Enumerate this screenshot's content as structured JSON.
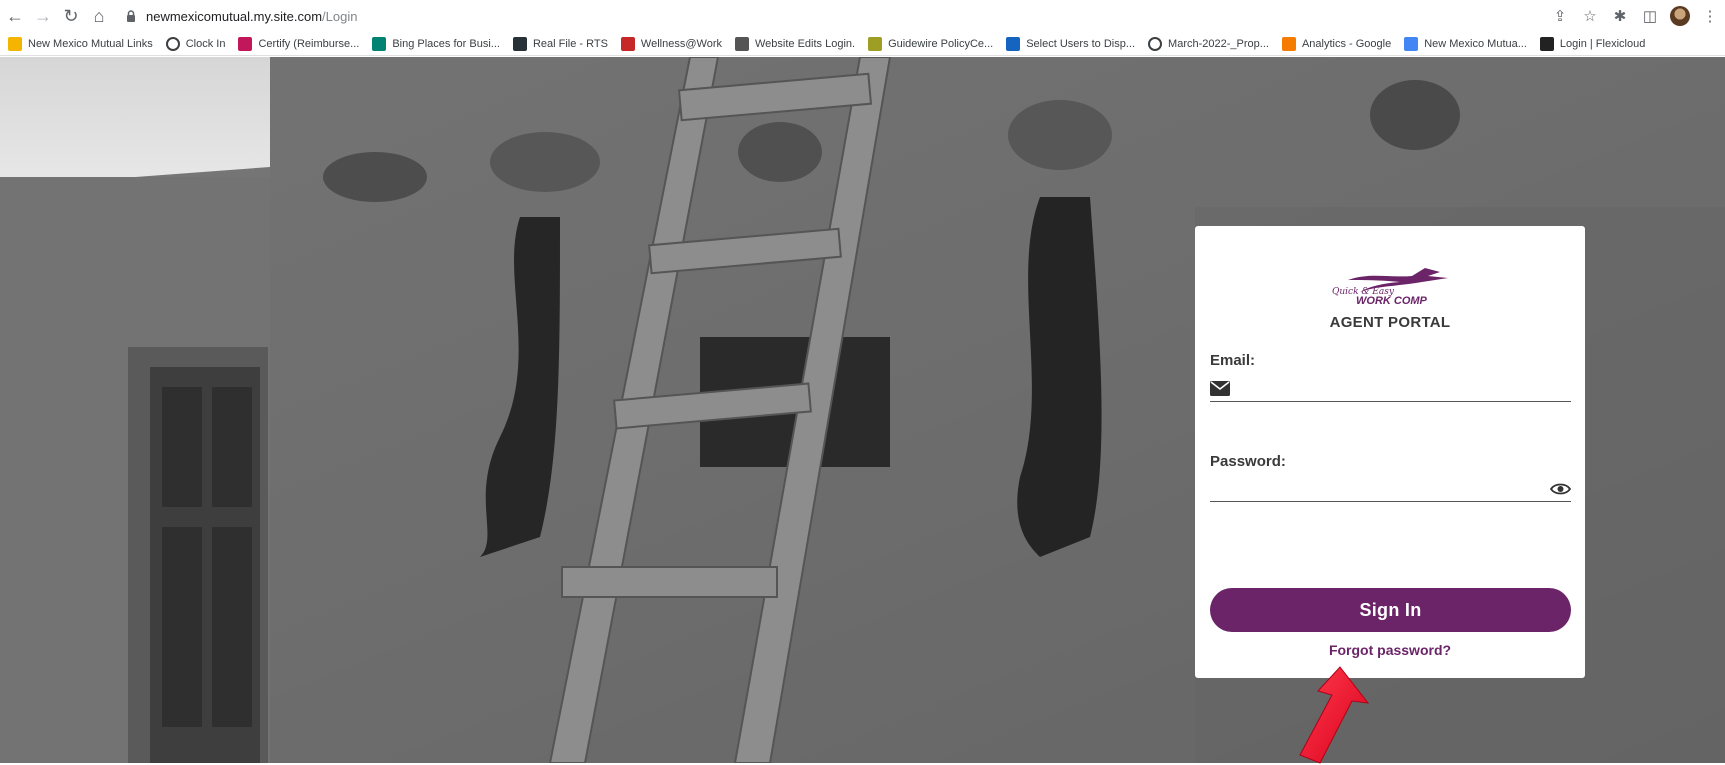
{
  "browser": {
    "url_host": "newmexicomutual.my.site.com",
    "url_path": "/Login"
  },
  "bookmarks": [
    {
      "label": "New Mexico Mutual Links",
      "icon": "folder-icon",
      "color": "#f4b400"
    },
    {
      "label": "Clock In",
      "icon": "globe-icon",
      "color": "#3c4043"
    },
    {
      "label": "Certify (Reimburse...",
      "icon": "certify-icon",
      "color": "#c2185b"
    },
    {
      "label": "Bing Places for Busi...",
      "icon": "bing-icon",
      "color": "#008373"
    },
    {
      "label": "Real File - RTS",
      "icon": "realfile-icon",
      "color": "#263238"
    },
    {
      "label": "Wellness@Work",
      "icon": "wellness-icon",
      "color": "#c62828"
    },
    {
      "label": "Website Edits Login.",
      "icon": "edits-icon",
      "color": "#555555"
    },
    {
      "label": "Guidewire PolicyCe...",
      "icon": "guidewire-icon",
      "color": "#9e9d24"
    },
    {
      "label": "Select Users to Disp...",
      "icon": "select-users-icon",
      "color": "#1565c0"
    },
    {
      "label": "March-2022-_Prop...",
      "icon": "globe-icon",
      "color": "#3c4043"
    },
    {
      "label": "Analytics - Google",
      "icon": "analytics-icon",
      "color": "#f57c00"
    },
    {
      "label": "New Mexico Mutua...",
      "icon": "google-icon",
      "color": "#4285f4"
    },
    {
      "label": "Login | Flexicloud",
      "icon": "flexicloud-icon",
      "color": "#222222"
    }
  ],
  "login": {
    "logo_script": "Quick & Easy",
    "logo_text": "WORK COMP",
    "portal_title": "AGENT PORTAL",
    "email_label": "Email:",
    "email_value": "",
    "password_label": "Password:",
    "password_value": "",
    "signin_label": "Sign In",
    "forgot_label": "Forgot password?",
    "brand_color": "#6b2468"
  }
}
